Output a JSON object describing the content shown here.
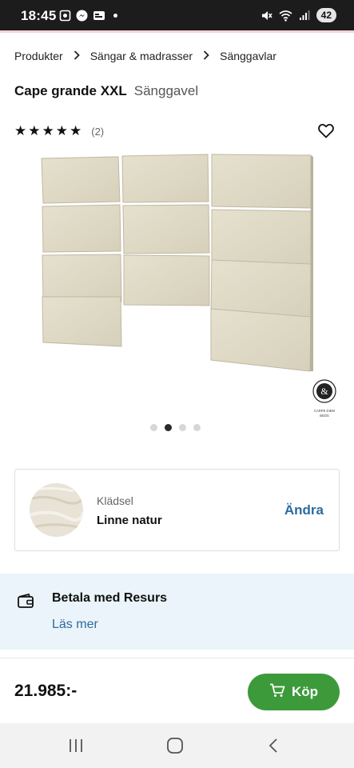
{
  "status_bar": {
    "time": "18:45",
    "battery": "42"
  },
  "breadcrumb": {
    "items": [
      "Produkter",
      "Sängar & madrasser",
      "Sänggavlar"
    ]
  },
  "product": {
    "name": "Cape grande XXL",
    "category": "Sänggavel",
    "rating": 5,
    "stars": [
      "★",
      "★",
      "★",
      "★",
      "★"
    ],
    "review_count": "(2)",
    "image_count": 4,
    "active_image_index": 1
  },
  "brand_logo": {
    "text": "CARPE DIEM BEDS"
  },
  "option": {
    "label": "Klädsel",
    "value": "Linne natur",
    "change_label": "Ändra"
  },
  "resurs": {
    "title": "Betala med Resurs",
    "link": "Läs mer"
  },
  "purchase": {
    "price": "21.985:-",
    "buy_label": "Köp"
  },
  "colors": {
    "accent_link": "#2d6a9f",
    "buy_green": "#3c9a3a",
    "info_bg": "#eaf4fa",
    "fabric": "#ddd7c3"
  },
  "icons": {
    "status": [
      "screenshot-icon",
      "messenger-icon",
      "news-icon",
      "mute-icon",
      "wifi-icon",
      "signal-icon"
    ],
    "heart": "heart-icon",
    "wallet": "wallet-icon",
    "cart": "cart-icon",
    "nav": [
      "recent-apps-icon",
      "home-icon",
      "back-icon"
    ]
  }
}
